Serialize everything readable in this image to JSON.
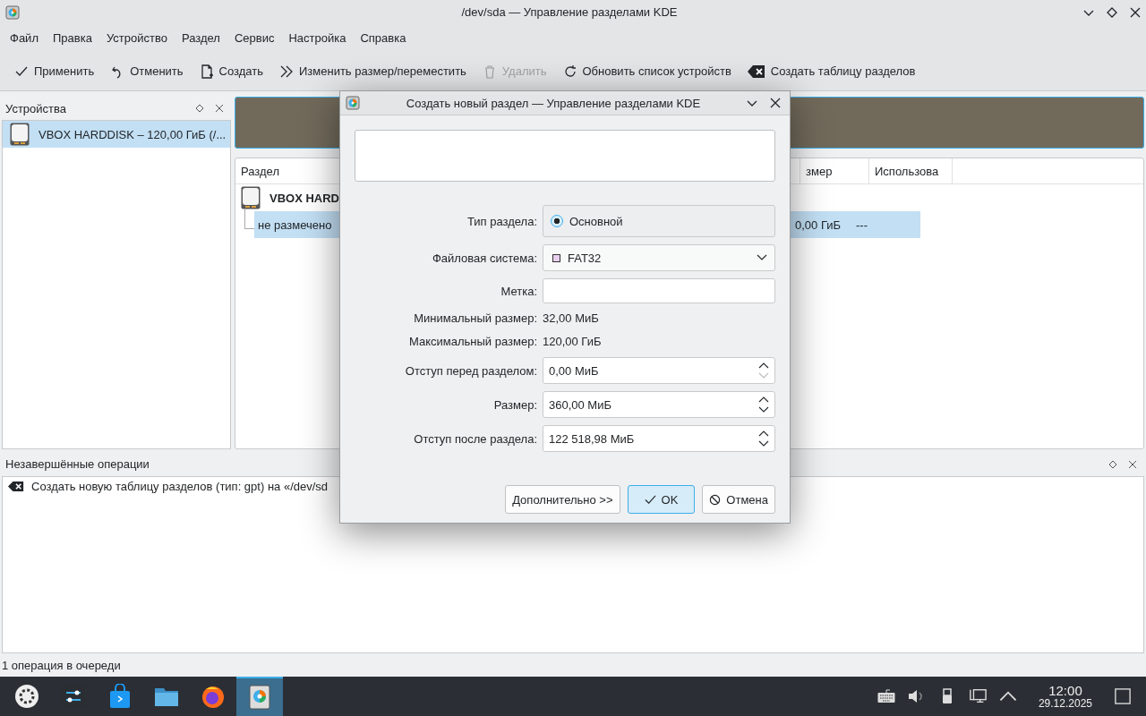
{
  "window": {
    "title": "/dev/sda — Управление разделами KDE"
  },
  "menu": [
    "Файл",
    "Правка",
    "Устройство",
    "Раздел",
    "Сервис",
    "Настройка",
    "Справка"
  ],
  "toolbar": [
    {
      "label": "Применить",
      "kind": "apply",
      "disabled": false
    },
    {
      "label": "Отменить",
      "kind": "undo",
      "disabled": false
    },
    {
      "label": "Создать",
      "kind": "new",
      "disabled": false
    },
    {
      "label": "Изменить размер/переместить",
      "kind": "resize",
      "disabled": false
    },
    {
      "label": "Удалить",
      "kind": "delete",
      "disabled": true
    },
    {
      "label": "Обновить список устройств",
      "kind": "refresh",
      "disabled": false
    },
    {
      "label": "Создать таблицу разделов",
      "kind": "table",
      "disabled": false
    }
  ],
  "devices_panel": {
    "title": "Устройства",
    "items": [
      {
        "label": "VBOX HARDDISK – 120,00 ГиБ (/...",
        "selected": true
      }
    ]
  },
  "partition_table": {
    "columns": [
      "Раздел",
      "змер",
      "Использова"
    ],
    "rows": [
      {
        "kind": "disk",
        "cells": [
          "VBOX HARD"
        ],
        "selected": false
      },
      {
        "kind": "partition",
        "cells": [
          "не размечено",
          "0,00 ГиБ",
          "---"
        ],
        "selected": true
      }
    ]
  },
  "operations_panel": {
    "title": "Незавершённые операции",
    "items": [
      "Создать новую таблицу разделов (тип: gpt) на «/dev/sd"
    ]
  },
  "status_bar": "1 операция в очереди",
  "dialog": {
    "title": "Создать новый раздел — Управление разделами KDE",
    "partition_type": {
      "label": "Тип раздела:",
      "option": "Основной",
      "selected": true
    },
    "filesystem": {
      "label": "Файловая система:",
      "value": "FAT32",
      "color": "#e8d0ee"
    },
    "fs_label": {
      "label": "Метка:"
    },
    "info": [
      {
        "label": "Минимальный размер:",
        "value": "32,00 МиБ"
      },
      {
        "label": "Максимальный размер:",
        "value": "120,00 ГиБ"
      }
    ],
    "spinboxes": [
      {
        "label": "Отступ перед разделом:",
        "value": "0,00 МиБ",
        "down_disabled": true
      },
      {
        "label": "Размер:",
        "value": "360,00 МиБ",
        "down_disabled": false
      },
      {
        "label": "Отступ после раздела:",
        "value": "122 518,98 МиБ",
        "down_disabled": false
      }
    ],
    "buttons": [
      {
        "label": "Дополнительно >>",
        "kind": "more",
        "default": false
      },
      {
        "label": "OK",
        "kind": "ok",
        "default": true
      },
      {
        "label": "Отмена",
        "kind": "cancel",
        "default": false
      }
    ]
  },
  "taskbar": {
    "apps": [
      {
        "kind": "launcher",
        "selected": false
      },
      {
        "kind": "settings",
        "selected": false
      },
      {
        "kind": "store",
        "selected": false
      },
      {
        "kind": "files",
        "selected": false
      },
      {
        "kind": "browser",
        "selected": false
      },
      {
        "kind": "partition-manager",
        "selected": true
      }
    ],
    "clock": {
      "time": "12:00",
      "date": "29.12.2025"
    }
  }
}
